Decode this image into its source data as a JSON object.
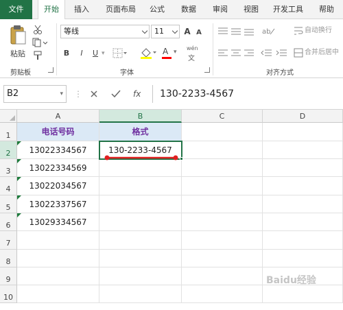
{
  "tabs": [
    "文件",
    "开始",
    "插入",
    "页面布局",
    "公式",
    "数据",
    "审阅",
    "视图",
    "开发工具",
    "帮助"
  ],
  "ribbon": {
    "clipboard": {
      "paste_label": "粘贴",
      "group_label": "剪贴板"
    },
    "font": {
      "font_name": "等线",
      "font_size": "11",
      "grow_label": "A",
      "shrink_label": "A",
      "bold": "B",
      "italic": "I",
      "underline": "U",
      "font_color_label": "A",
      "phonetic_label": "wén",
      "group_label": "字体"
    },
    "alignment": {
      "wrap_text_label": "自动换行",
      "merge_center_label": "合并后居中",
      "group_label": "对齐方式"
    }
  },
  "formula_bar": {
    "name_box": "B2",
    "fx_label": "fx",
    "content": "130-2233-4567"
  },
  "grid": {
    "columns": [
      "A",
      "B",
      "C",
      "D"
    ],
    "rows": [
      "1",
      "2",
      "3",
      "4",
      "5",
      "6",
      "7",
      "8",
      "9",
      "10"
    ],
    "cells": {
      "A1": "电话号码",
      "B1": "格式",
      "A2": "13022334567",
      "B2": "130-2233-4567",
      "A3": "13022334569",
      "A4": "13022034567",
      "A5": "13022337567",
      "A6": "13029334567"
    }
  },
  "annotation": {
    "color": "#e02020"
  },
  "watermark": {
    "text": "Baidu经验"
  }
}
